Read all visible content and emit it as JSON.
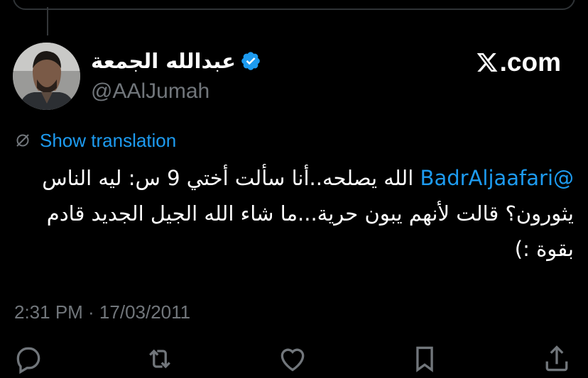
{
  "author": {
    "display_name": "عبدالله الجمعة",
    "handle": "@AAlJumah",
    "verified": true
  },
  "brand": {
    "label": ".com",
    "logo_icon": "x-logo-icon"
  },
  "translation": {
    "icon": "translate-icon",
    "label": "Show translation"
  },
  "tweet": {
    "mention": "@BadrAljaafari",
    "body": " الله يصلحه..أنا سألت أختي 9 س: ليه الناس يثورون؟ قالت لأنهم يبون حرية...ما شاء الله الجيل الجديد قادم بقوة :)"
  },
  "timestamp": "2:31 PM · 17/03/2011",
  "actions": [
    {
      "name": "reply-icon"
    },
    {
      "name": "retweet-icon"
    },
    {
      "name": "like-icon"
    },
    {
      "name": "bookmark-icon"
    },
    {
      "name": "share-icon"
    }
  ],
  "colors": {
    "background": "#000000",
    "text": "#ffffff",
    "secondary_text": "#71767b",
    "accent": "#1d9bf0"
  }
}
